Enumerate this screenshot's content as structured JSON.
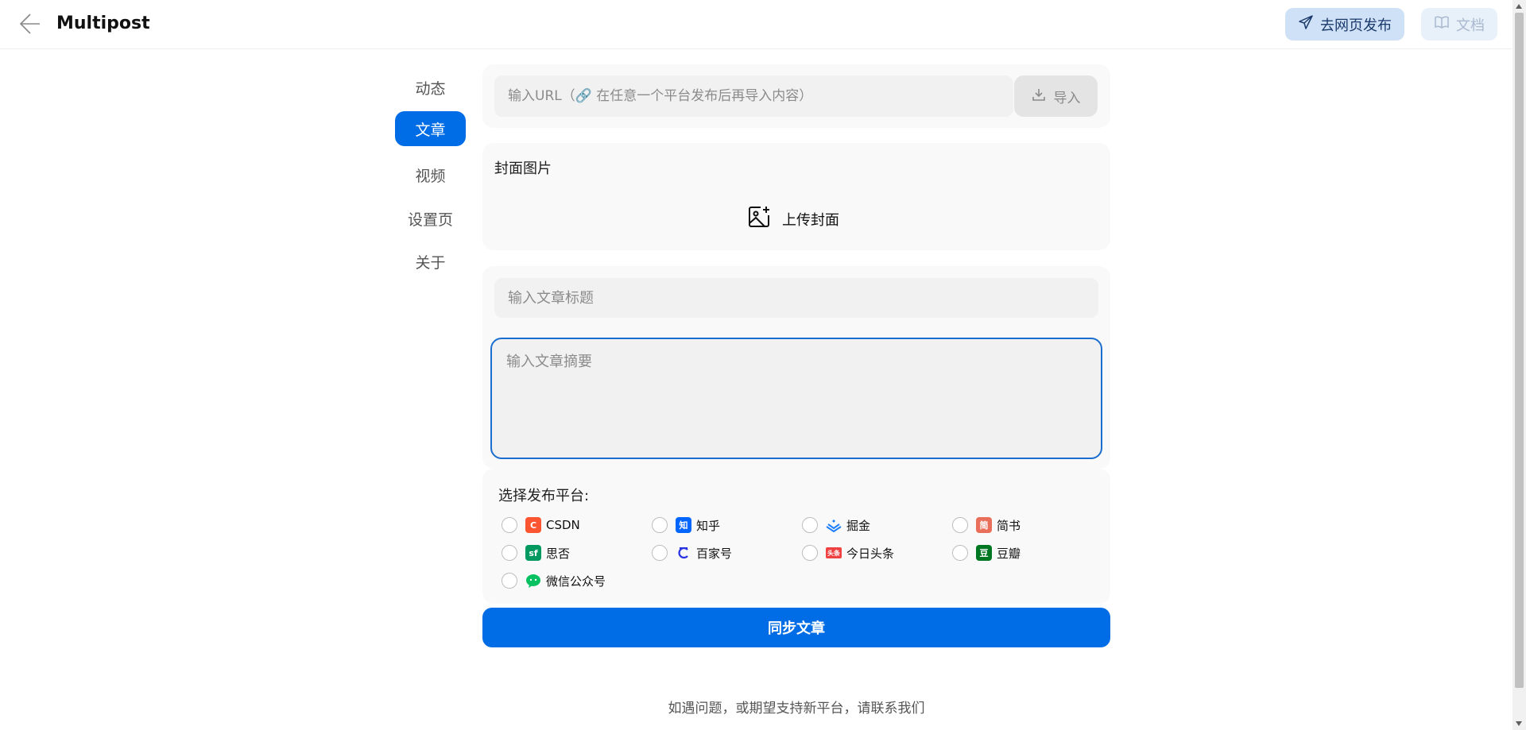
{
  "header": {
    "app_title": "Multipost",
    "publish_web_label": "去网页发布",
    "docs_label": "文档",
    "colors": {
      "publish_bg": "#cfe1f7",
      "docs_bg": "#e8f0fa"
    }
  },
  "sidebar": {
    "items": [
      {
        "label": "动态",
        "active": false
      },
      {
        "label": "文章",
        "active": true
      },
      {
        "label": "视频",
        "active": false
      },
      {
        "label": "设置页",
        "active": false
      },
      {
        "label": "关于",
        "active": false
      }
    ],
    "accent": "#006de6"
  },
  "import": {
    "url_placeholder": "输入URL（🔗 在任意一个平台发布后再导入内容）",
    "url_value": "",
    "import_label": "导入"
  },
  "cover": {
    "label": "封面图片",
    "upload_label": "上传封面"
  },
  "article": {
    "title_placeholder": "输入文章标题",
    "title_value": "",
    "summary_placeholder": "输入文章摘要",
    "summary_value": ""
  },
  "platforms": {
    "label": "选择发布平台:",
    "items": [
      {
        "name": "CSDN",
        "icon": "csdn-icon",
        "glyph": "C",
        "color": "#fc5531",
        "checked": false
      },
      {
        "name": "知乎",
        "icon": "zhihu-icon",
        "glyph": "知",
        "color": "#0066ff",
        "checked": false
      },
      {
        "name": "掘金",
        "icon": "juejin-icon",
        "glyph": "",
        "color": "#1e80ff",
        "checked": false
      },
      {
        "name": "简书",
        "icon": "jianshu-icon",
        "glyph": "简",
        "color": "#ea6f5a",
        "checked": false
      },
      {
        "name": "思否",
        "icon": "segmentfault-icon",
        "glyph": "sf",
        "color": "#009a61",
        "checked": false
      },
      {
        "name": "百家号",
        "icon": "baijiahao-icon",
        "glyph": "",
        "color": "#2932e1",
        "checked": false
      },
      {
        "name": "今日头条",
        "icon": "toutiao-icon",
        "glyph": "头条",
        "color": "#f04142",
        "checked": false
      },
      {
        "name": "豆瓣",
        "icon": "douban-icon",
        "glyph": "豆",
        "color": "#007722",
        "checked": false
      },
      {
        "name": "微信公众号",
        "icon": "wechat-icon",
        "glyph": "",
        "color": "#07c160",
        "checked": false
      }
    ]
  },
  "actions": {
    "sync_label": "同步文章"
  },
  "footer": {
    "text": "如遇问题，或期望支持新平台，请联系我们"
  }
}
